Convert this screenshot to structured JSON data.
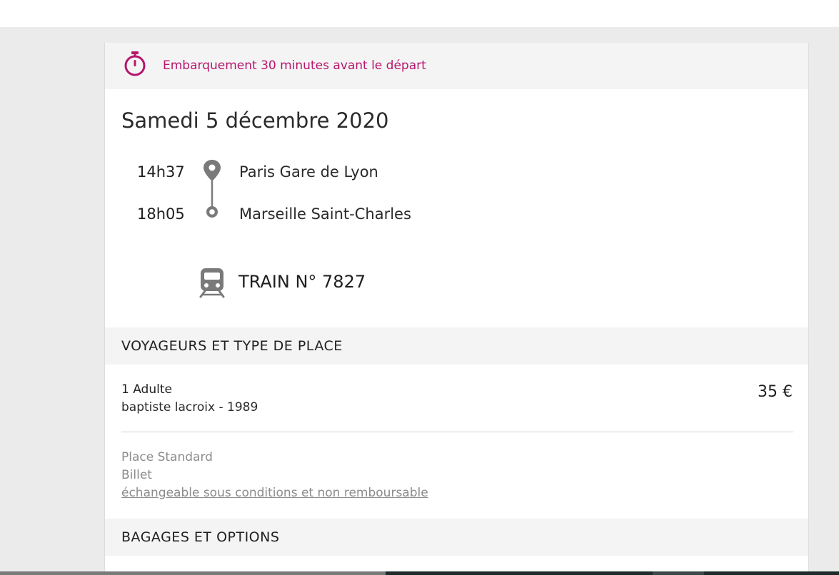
{
  "notice": {
    "icon": "stopwatch-icon",
    "text": "Embarquement 30 minutes avant le départ",
    "color": "#b5176c"
  },
  "journey": {
    "date": "Samedi 5 décembre 2020",
    "departure": {
      "time": "14h37",
      "station": "Paris Gare de Lyon"
    },
    "arrival": {
      "time": "18h05",
      "station": "Marseille Saint-Charles"
    },
    "train_icon": "train-icon",
    "train_label": "TRAIN N° 7827"
  },
  "travellers": {
    "header": "VOYAGEURS ET TYPE DE PLACE",
    "passenger_type": "1 Adulte",
    "passenger_name": "baptiste lacroix - 1989",
    "price": "35 €",
    "seat_class": "Place Standard",
    "ticket_label": "Billet",
    "conditions_link": "échangeable sous conditions et non remboursable"
  },
  "options": {
    "header": "BAGAGES ET OPTIONS"
  }
}
